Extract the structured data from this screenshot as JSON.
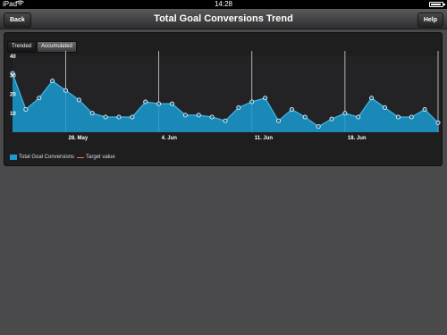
{
  "status_bar": {
    "device": "iPad",
    "wifi_icon": "wifi-icon",
    "time": "14:28",
    "battery_icon": "battery-icon"
  },
  "nav": {
    "back_label": "Back",
    "title": "Total Goal Conversions Trend",
    "help_label": "Help"
  },
  "tabs": [
    {
      "label": "Trended",
      "active": false
    },
    {
      "label": "Accumulated",
      "active": true
    }
  ],
  "colors": {
    "series_fill": "#1a9bd1",
    "series_line": "#3fb8e8",
    "target_line": "#e07a4a"
  },
  "chart_data": {
    "type": "area",
    "title": "",
    "xlabel": "",
    "ylabel": "",
    "ylim": [
      0,
      40
    ],
    "y_ticks": [
      10,
      20,
      30,
      40
    ],
    "x_ticks": [
      {
        "label": "28. May",
        "index": 4
      },
      {
        "label": "4. Jun",
        "index": 11
      },
      {
        "label": "11. Jun",
        "index": 18
      },
      {
        "label": "18. Jun",
        "index": 25
      }
    ],
    "series": [
      {
        "name": "Total Goal Conversions",
        "values": [
          31,
          12,
          18,
          27,
          22,
          17,
          10,
          8,
          8,
          8,
          16,
          15,
          15,
          9,
          9,
          8,
          6,
          13,
          16,
          18,
          6,
          12,
          8,
          3,
          7,
          10,
          8,
          18,
          13,
          8,
          8,
          12,
          5
        ]
      }
    ],
    "legend": [
      "Total Goal Conversions",
      "Target value"
    ],
    "legend_position": "bottom-left",
    "grid": false
  }
}
